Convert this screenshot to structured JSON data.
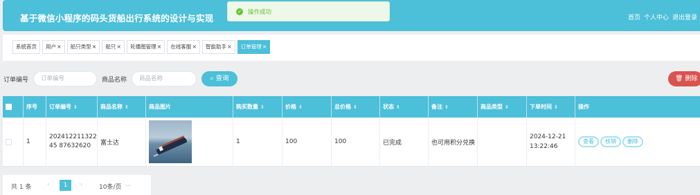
{
  "header": {
    "title": "基于微信小程序的码头货船出行系统的设计与实现",
    "links": [
      "首页",
      "个人中心",
      "退出登录"
    ]
  },
  "toast": {
    "icon": "success-check-icon",
    "text": "操作成功"
  },
  "tabs": [
    {
      "label": "系统首页",
      "closable": false
    },
    {
      "label": "用户",
      "closable": true
    },
    {
      "label": "船只类型",
      "closable": true
    },
    {
      "label": "船只",
      "closable": true
    },
    {
      "label": "轮播图管理",
      "closable": true
    },
    {
      "label": "在线客服",
      "closable": true
    },
    {
      "label": "智能助手",
      "closable": true
    },
    {
      "label": "订单管理",
      "closable": true,
      "active": true
    }
  ],
  "search": {
    "order_no_label": "订单编号",
    "order_no_placeholder": "订单编号",
    "product_label": "商品名称",
    "product_placeholder": "商品名称",
    "search_button": "查询",
    "delete_button": "删除"
  },
  "table": {
    "columns": [
      "序号",
      "订单编号",
      "商品名称",
      "商品图片",
      "购买数量",
      "价格",
      "总价格",
      "状态",
      "备注",
      "商品类型",
      "下单时间",
      "操作"
    ],
    "rows": [
      {
        "index": "1",
        "order_no": "20241221132245876 32620",
        "order_no_display": "20241221132245 87632620",
        "product_name": "富士达",
        "quantity": "1",
        "price": "100",
        "total": "100",
        "status": "已完成",
        "remark": "也可用积分兑换",
        "product_type": "",
        "order_time": "2024-12-21 13:22:46",
        "actions": [
          "查看",
          "核销",
          "删除"
        ]
      }
    ]
  },
  "pager": {
    "total": "共 1 条",
    "current_page": "1",
    "page_size": "10条/页"
  },
  "colors": {
    "accent": "#4cbfd9",
    "danger": "#d9534f",
    "success": "#67c23a"
  }
}
